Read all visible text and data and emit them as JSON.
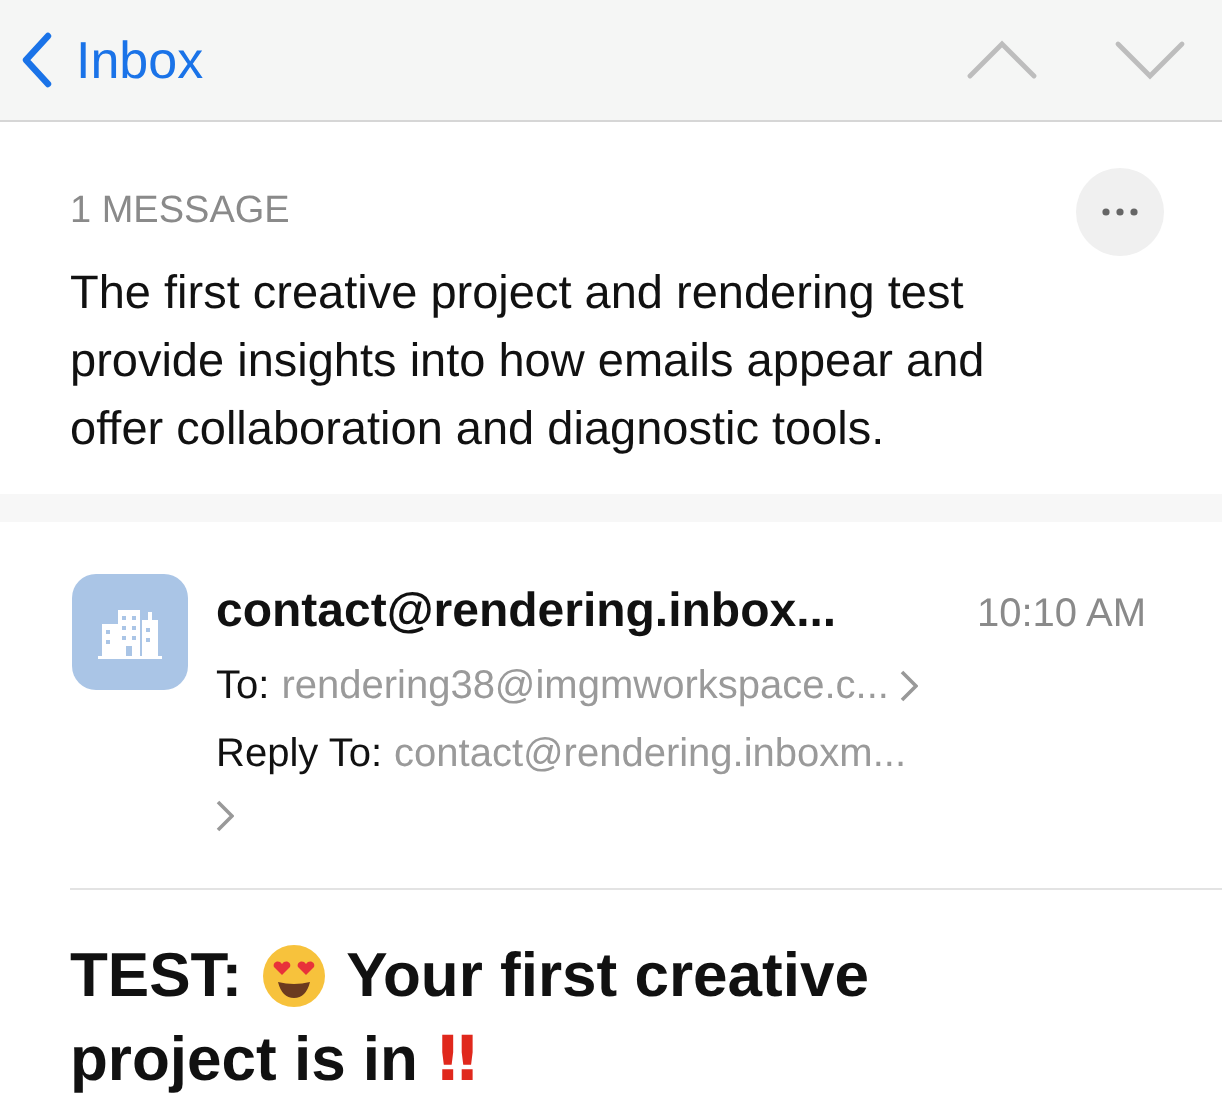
{
  "nav": {
    "back_label": "Inbox"
  },
  "thread": {
    "count_label": "1 MESSAGE",
    "summary": "The first creative project and rendering test provide insights into how emails appear and offer collaboration and diagnostic tools."
  },
  "message": {
    "sender": "contact@rendering.inbox...",
    "time": "10:10 AM",
    "to_label": "To:",
    "to": "rendering38@imgmworkspace.c...",
    "reply_to_label": "Reply To:",
    "reply_to": "contact@rendering.inboxm..."
  },
  "subject": [
    {
      "kind": "text",
      "text": "TEST:"
    },
    {
      "kind": "emoji"
    },
    {
      "kind": "text",
      "text": "Your first creative"
    },
    {
      "kind": "text",
      "text": "project is in"
    },
    {
      "kind": "mark",
      "text": "‼"
    }
  ]
}
